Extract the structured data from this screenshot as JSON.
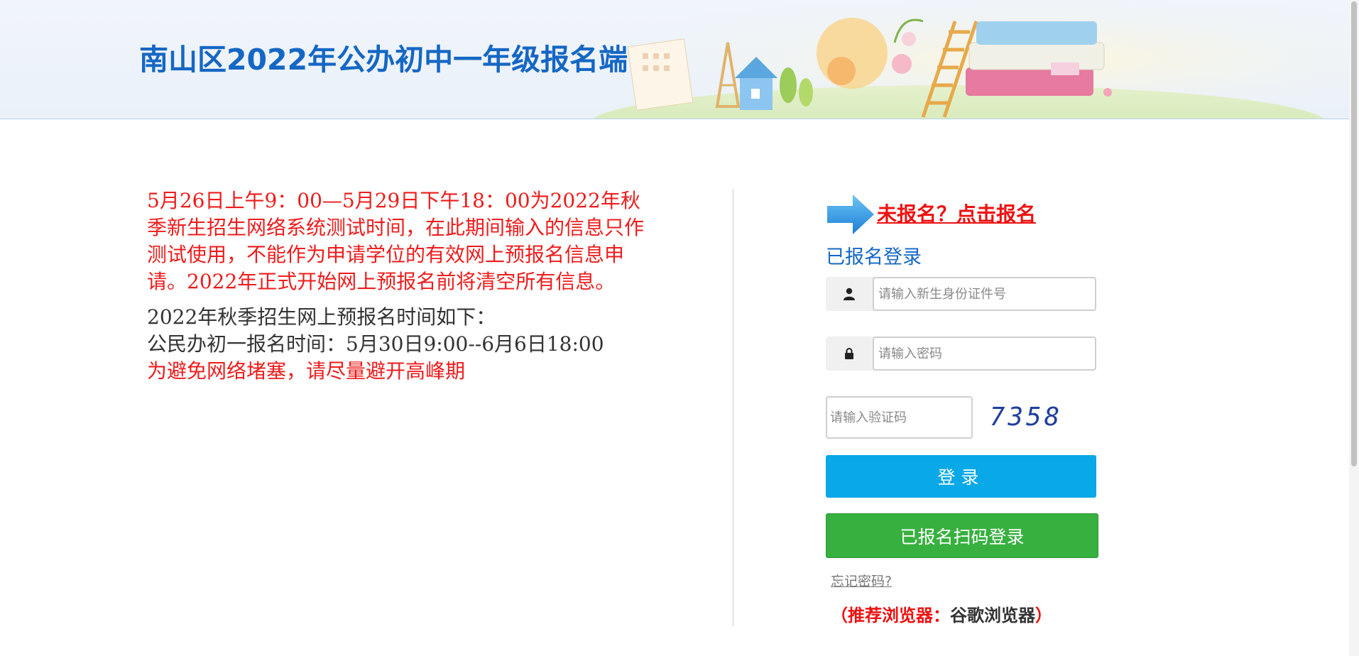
{
  "header": {
    "title": "南山区2022年公办初中一年级报名端"
  },
  "notice": {
    "warning": "5月26日上午9：00—5月29日下午18：00为2022年秋季新生招生网络系统测试时间，在此期间输入的信息只作测试使用，不能作为申请学位的有效网上预报名信息申请。2022年正式开始网上预报名前将清空所有信息。",
    "schedule_intro": "2022年秋季招生网上预报名时间如下：",
    "schedule_time": "公民办初一报名时间：5月30日9:00--6月6日18:00",
    "congestion_tip": "为避免网络堵塞，请尽量避开高峰期"
  },
  "login": {
    "register_link": "未报名？点击报名",
    "heading": "已报名登录",
    "id_placeholder": "请输入新生身份证件号",
    "password_placeholder": "请输入密码",
    "captcha_placeholder": "请输入验证码",
    "captcha_code": "7358",
    "login_button": "登录",
    "scan_button": "已报名扫码登录",
    "forgot_password": "忘记密码?",
    "browser_tip_open": "（",
    "browser_tip_label": "推荐浏览器：",
    "browser_tip_value": "谷歌浏览器",
    "browser_tip_close": "）"
  },
  "icons": {
    "user": "user-icon",
    "lock": "lock-icon",
    "arrow": "arrow-right-icon"
  },
  "colors": {
    "brand_blue": "#1567c4",
    "alert_red": "#ee1c1c",
    "login_button": "#09a8e6",
    "scan_button": "#37b03f"
  }
}
